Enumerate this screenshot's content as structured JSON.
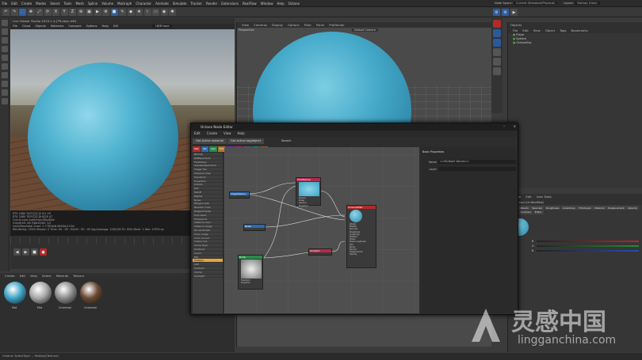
{
  "menubar": [
    "File",
    "Edit",
    "Create",
    "Modes",
    "Select",
    "Tools",
    "Mesh",
    "Spline",
    "Volume",
    "MoGraph",
    "Character",
    "Animate",
    "Simulate",
    "Tracker",
    "Render",
    "Extensions",
    "RealFlow",
    "Window",
    "Help",
    "Octane"
  ],
  "menubar_right": {
    "node_space_label": "Node Space:",
    "node_space_value": "Current (Standard/Physical)",
    "layout_label": "Layout:",
    "layout_value": "Startup (User)"
  },
  "live_viewer": {
    "title": "Live Viewer Studio 2019.1.4-[TR-days left]",
    "menu": [
      "File",
      "Cloud",
      "Objects",
      "Materials",
      "Compare",
      "Options",
      "Help",
      "GUI"
    ],
    "hdr_tonemap": "HDR tone"
  },
  "live_stats": [
    "RTX 2080 Ti[P1]T|C|5    9/1  29",
    "RTX 2080 Ti[P1]T|C|8      8/28  47",
    "Out-of-core used/max:0Kb/8Gb",
    "Grey8/16: 0/0            Rgb32/64: 1/2",
    "Used/free/total vram: 2.776Gb/6.964Gb/11Gb",
    "Rendering: 100%  Ms/sec: 0   Time: 00 : 00 : 00/00 : 00 : 00   Spp/maxspp: 128/128   Tri: 0/5k   Mesh: 1   Hair: 0   RTX:on"
  ],
  "viewport": {
    "menu": [
      "View",
      "Cameras",
      "Display",
      "Options",
      "Filter",
      "Panel",
      "ProRender"
    ],
    "label": "Perspective",
    "camera": "Default Camera"
  },
  "objects": {
    "title": "Objects",
    "menu": [
      "File",
      "Edit",
      "View",
      "Object",
      "Tags",
      "Bookmarks"
    ],
    "items": [
      "Plane",
      "Sphere",
      "OctaneSky"
    ]
  },
  "attributes": {
    "menu": [
      "Mode",
      "Edit",
      "User Data"
    ],
    "title": "Universal (UnifiedMat)",
    "tabs": [
      "Basic",
      "Albedo",
      "Specular",
      "Roughness",
      "Anisotropy",
      "Film/Layer",
      "Material",
      "Displacement",
      "Opacity",
      "Index",
      "Common",
      "Editor"
    ],
    "rgb": [
      "R",
      "G",
      "B"
    ]
  },
  "materials": {
    "menu": [
      "Create",
      "Edit",
      "View",
      "Select",
      "Material",
      "Texture"
    ],
    "items": [
      "Mat",
      "Mat",
      "Universal",
      "Universal"
    ],
    "colors": [
      "#3fa4c6",
      "#a8a8a8",
      "#8c8c8c",
      "#6a4a34"
    ]
  },
  "status_text": "Octane:  ActiveType: -- Multiply(Texture)",
  "node_editor": {
    "title": "Octane Node Editor",
    "menu": [
      "Edit",
      "Create",
      "View",
      "Help"
    ],
    "buttons": [
      "Get Active material",
      "Get Active tag/object",
      "Search"
    ],
    "tabs": [
      {
        "label": "Mat",
        "color": "#b22a2a"
      },
      {
        "label": "Tex",
        "color": "#2a6ab2"
      },
      {
        "label": "Gen",
        "color": "#2a8a4a"
      },
      {
        "label": "Emi",
        "color": "#b2762a"
      },
      {
        "label": "Med",
        "color": "#7a2ab2"
      },
      {
        "label": "Map",
        "color": "#a22a7a"
      },
      {
        "label": "Dis",
        "color": "#5a5a5a"
      },
      {
        "label": "Obj",
        "color": "#2a7a7a"
      },
      {
        "label": "Mix",
        "color": "#8a5a2a"
      }
    ],
    "node_list": [
      "Bitmap",
      "RGBSpectrum",
      "FloatValue",
      "Gaussianspectrum",
      "Image Tile",
      "Triplanar map",
      "Transform",
      "Projection",
      "Checks",
      "Dirt",
      "Falloff",
      "Marble",
      "Noise",
      "Polygon side",
      "Random color",
      "Ridged fractal",
      "Sine wave",
      "Turbulence",
      "Instance color",
      "Instance range",
      "W coordinate",
      "Color range",
      "Color correct",
      "Cosine mix",
      "Comp layer",
      "Gradient",
      "Invert",
      "Mix",
      "Multiply",
      "Add",
      "Subtract",
      "Clamp",
      "Spotlight"
    ],
    "nodes": {
      "a": "ImageTexture",
      "b": "FloatTexture",
      "c": "Noise",
      "d": "Bump",
      "e": "Gradient",
      "f": "UniversalMat"
    },
    "ports_b": [
      "Texture",
      "Power",
      "Gamma",
      "Projection"
    ],
    "ports_c": [
      "Transform",
      "Projection"
    ],
    "ports_f": [
      "Albedo",
      "Metallic",
      "Specular",
      "Roughness",
      "Anisotropy",
      "Rotation",
      "Sheen",
      "Sheen roughness",
      "Film",
      "Bump",
      "Normal",
      "Displacement",
      "Opacity"
    ],
    "properties": {
      "title": "Basic Properties",
      "name_label": "Name",
      "name_value": "<<Multiple Values>>",
      "layer_label": "Layer"
    }
  },
  "watermark": {
    "cn": "灵感中国",
    "en": "lingganchina.com"
  }
}
